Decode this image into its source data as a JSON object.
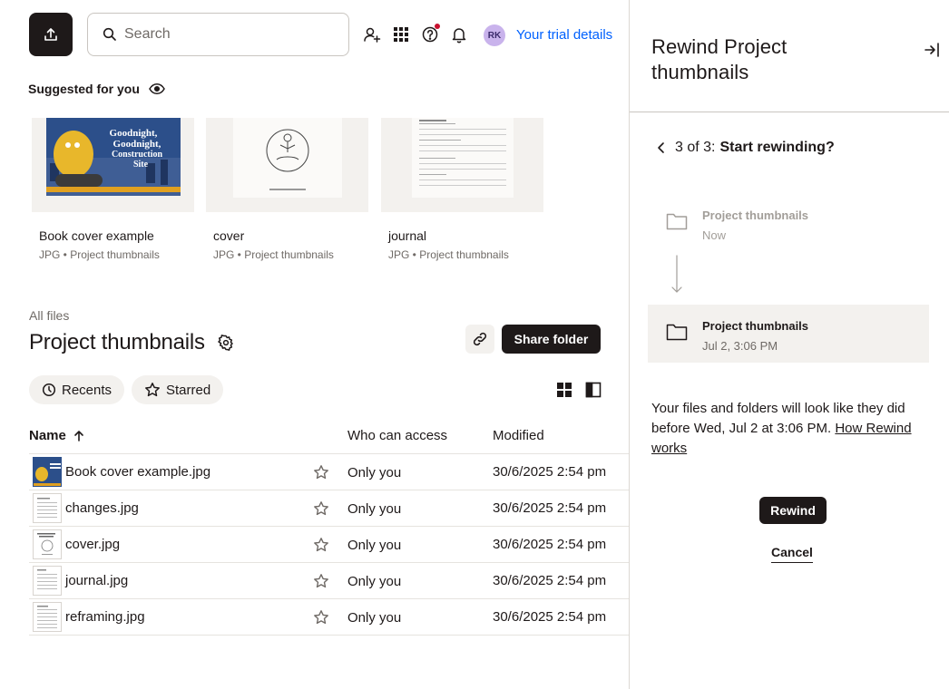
{
  "header": {
    "upload_icon": "upload-icon",
    "search_placeholder": "Search",
    "icons": [
      "add-user-icon",
      "apps-grid-icon",
      "help-icon",
      "bell-icon"
    ],
    "avatar_initials": "RK",
    "trial_link": "Your trial details",
    "colors": {
      "accent": "#0061fe",
      "primary": "#1e1919",
      "notification": "#c8102e",
      "avatar": "#c9b3ec"
    }
  },
  "suggested": {
    "title": "Suggested for you",
    "items": [
      {
        "name": "Book cover example",
        "meta": "JPG • Project thumbnails"
      },
      {
        "name": "cover",
        "meta": "JPG • Project thumbnails"
      },
      {
        "name": "journal",
        "meta": "JPG • Project thumbnails"
      }
    ]
  },
  "folder": {
    "breadcrumb": "All files",
    "title": "Project thumbnails",
    "share_label": "Share folder",
    "filters": [
      {
        "label": "Recents",
        "icon": "clock-icon"
      },
      {
        "label": "Starred",
        "icon": "star-icon"
      }
    ]
  },
  "table": {
    "columns": {
      "name": "Name",
      "access": "Who can access",
      "modified": "Modified"
    },
    "rows": [
      {
        "name": "Book cover example.jpg",
        "access": "Only you",
        "modified": "30/6/2025 2:54 pm"
      },
      {
        "name": "changes.jpg",
        "access": "Only you",
        "modified": "30/6/2025 2:54 pm"
      },
      {
        "name": "cover.jpg",
        "access": "Only you",
        "modified": "30/6/2025 2:54 pm"
      },
      {
        "name": "journal.jpg",
        "access": "Only you",
        "modified": "30/6/2025 2:54 pm"
      },
      {
        "name": "reframing.jpg",
        "access": "Only you",
        "modified": "30/6/2025 2:54 pm"
      }
    ]
  },
  "rewind": {
    "title": "Rewind Project thumbnails",
    "step_prefix": "3 of 3:",
    "step_label": "Start rewinding?",
    "current": {
      "name": "Project thumbnails",
      "date": "Now"
    },
    "target": {
      "name": "Project thumbnails",
      "date": "Jul 2, 3:06 PM"
    },
    "explanation": "Your files and folders will look like they did before Wed, Jul 2 at 3:06 PM.",
    "help_link": "How Rewind works",
    "rewind_label": "Rewind",
    "cancel_label": "Cancel"
  }
}
